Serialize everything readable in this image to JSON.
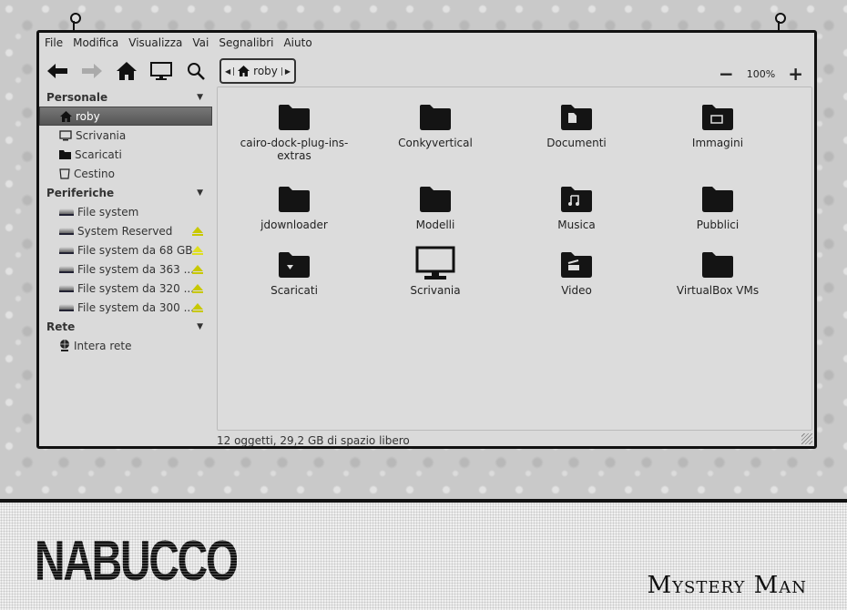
{
  "menu": [
    "File",
    "Modifica",
    "Visualizza",
    "Vai",
    "Segnalibri",
    "Aiuto"
  ],
  "breadcrumb": {
    "current": "roby"
  },
  "zoom": {
    "level": "100%"
  },
  "sidebar": {
    "personal": {
      "title": "Personale",
      "items": [
        "roby",
        "Scrivania",
        "Scaricati",
        "Cestino"
      ]
    },
    "devices": {
      "title": "Periferiche",
      "items": [
        "File system",
        "System Reserved",
        "File system da 68 GB",
        "File system da 363 ...",
        "File system da 320 ...",
        "File system da 300 ..."
      ]
    },
    "network": {
      "title": "Rete",
      "items": [
        "Intera rete"
      ]
    }
  },
  "files": [
    {
      "name": "cairo-dock-plug-ins-extras",
      "icon": "folder"
    },
    {
      "name": "Conkyvertical",
      "icon": "folder"
    },
    {
      "name": "Documenti",
      "icon": "folder-documents"
    },
    {
      "name": "Immagini",
      "icon": "folder-pictures"
    },
    {
      "name": "jdownloader",
      "icon": "folder"
    },
    {
      "name": "Modelli",
      "icon": "folder"
    },
    {
      "name": "Musica",
      "icon": "folder-music"
    },
    {
      "name": "Pubblici",
      "icon": "folder"
    },
    {
      "name": "Scaricati",
      "icon": "folder-download"
    },
    {
      "name": "Scrivania",
      "icon": "desktop"
    },
    {
      "name": "Video",
      "icon": "folder-video"
    },
    {
      "name": "VirtualBox VMs",
      "icon": "folder"
    }
  ],
  "status": "12 oggetti, 29,2 GB di spazio libero",
  "footer": {
    "logo": "NABUCCO",
    "signature": "Mystery Man"
  },
  "colors": {
    "eject": "#c8c800",
    "selection": "#606060"
  }
}
